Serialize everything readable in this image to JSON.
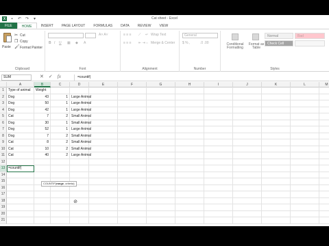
{
  "window": {
    "title": "Cat sheet - Excel"
  },
  "tabs": [
    "FILE",
    "HOME",
    "INSERT",
    "PAGE LAYOUT",
    "FORMULAS",
    "DATA",
    "REVIEW",
    "VIEW"
  ],
  "ribbon": {
    "clipboard": {
      "paste": "Paste",
      "cut": "Cut",
      "copy": "Copy",
      "format_painter": "Format Painter",
      "label": "Clipboard"
    },
    "font": {
      "label": "Font"
    },
    "alignment": {
      "wrap_text": "Wrap Text",
      "merge_center": "Merge & Center",
      "label": "Alignment"
    },
    "number": {
      "format": "General",
      "label": "Number"
    },
    "styles": {
      "conditional": "Conditional Formatting",
      "format_as_table": "Format as Table",
      "normal": "Normal",
      "bad": "Bad",
      "check_cell": "Check Cell",
      "label": "Styles"
    }
  },
  "formula_bar": {
    "name_box": "SUM",
    "fx": "fx",
    "formula": "=countif("
  },
  "columns": [
    "A",
    "B",
    "C",
    "D",
    "E",
    "F",
    "G",
    "H",
    "I",
    "J",
    "K",
    "L",
    "M"
  ],
  "rows": [
    [
      "1",
      "Type of animal",
      "Weight",
      "",
      ""
    ],
    [
      "2",
      "Dog",
      "43",
      "1",
      "Large Animal"
    ],
    [
      "3",
      "Dog",
      "50",
      "1",
      "Large Animal"
    ],
    [
      "4",
      "Dog",
      "42",
      "1",
      "Large Animal"
    ],
    [
      "5",
      "Cat",
      "7",
      "2",
      "Small Animal"
    ],
    [
      "6",
      "Dog",
      "30",
      "1",
      "Small Animal"
    ],
    [
      "7",
      "Dog",
      "52",
      "1",
      "Large Animal"
    ],
    [
      "8",
      "Dog",
      "7",
      "2",
      "Small Animal"
    ],
    [
      "9",
      "Cat",
      "8",
      "2",
      "Small Animal"
    ],
    [
      "10",
      "Cat",
      "10",
      "2",
      "Small Animal"
    ],
    [
      "11",
      "Cat",
      "40",
      "2",
      "Large Animal"
    ],
    [
      "12",
      "",
      "",
      "",
      ""
    ],
    [
      "13",
      "=countif(",
      "",
      "",
      ""
    ],
    [
      "14",
      "",
      "",
      "",
      ""
    ],
    [
      "15",
      "",
      "",
      "",
      ""
    ],
    [
      "16",
      "",
      "",
      "",
      ""
    ],
    [
      "17",
      "",
      "",
      "",
      ""
    ],
    [
      "18",
      "",
      "",
      "",
      ""
    ],
    [
      "19",
      "",
      "",
      "",
      ""
    ],
    [
      "20",
      "",
      "",
      "",
      ""
    ],
    [
      "21",
      "",
      "",
      "",
      ""
    ]
  ],
  "tooltip": {
    "func": "COUNTIF(",
    "arg1": "range",
    "rest": ", criteria)"
  },
  "colors": {
    "excel_green": "#217346",
    "file_tab": "#217346",
    "bad_style": "#ffc7ce",
    "check_cell": "#a5a5a5"
  }
}
